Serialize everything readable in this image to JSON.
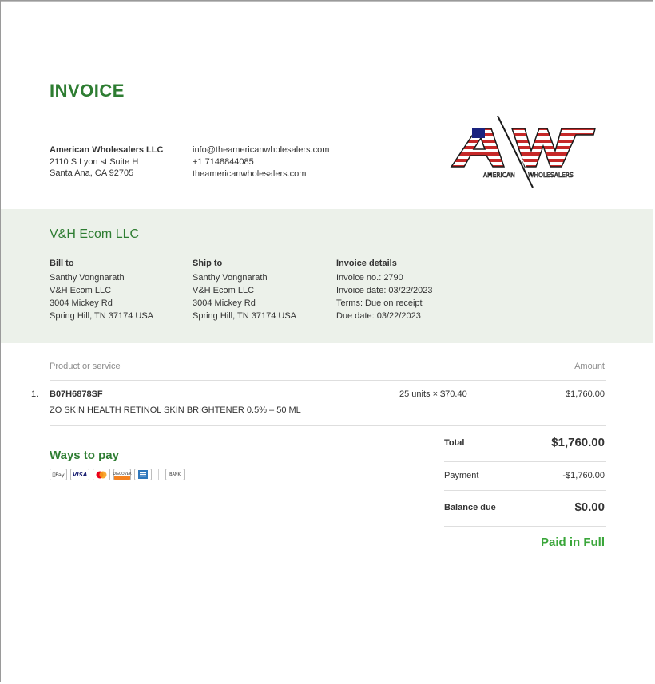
{
  "invoice": {
    "title": "INVOICE"
  },
  "seller": {
    "name": "American Wholesalers LLC",
    "address_line1": "2110 S Lyon st Suite H",
    "address_line2": "Santa Ana, CA 92705",
    "email": "info@theamericanwholesalers.com",
    "phone": "+1 7148844085",
    "website": "theamericanwholesalers.com",
    "logo": {
      "mark": "AW",
      "subtitle_left": "AMERICAN",
      "subtitle_right": "WHOLESALERS"
    }
  },
  "customer": {
    "name": "V&H Ecom LLC"
  },
  "bill_to": {
    "heading": "Bill to",
    "lines": [
      "Santhy Vongnarath",
      "V&H Ecom LLC",
      "3004 Mickey Rd",
      "Spring Hill, TN 37174 USA"
    ]
  },
  "ship_to": {
    "heading": "Ship to",
    "lines": [
      "Santhy Vongnarath",
      "V&H Ecom LLC",
      "3004 Mickey Rd",
      "Spring Hill, TN 37174 USA"
    ]
  },
  "invoice_details": {
    "heading": "Invoice details",
    "lines": [
      "Invoice no.: 2790",
      "Invoice date: 03/22/2023",
      "Terms: Due on receipt",
      "Due date: 03/22/2023"
    ]
  },
  "table": {
    "col_product": "Product or service",
    "col_amount": "Amount",
    "items": [
      {
        "no": "1.",
        "sku": "B07H6878SF",
        "description": "ZO SKIN HEALTH RETINOL SKIN BRIGHTENER 0.5% – 50 ML",
        "qty_price": "25 units × $70.40",
        "amount": "$1,760.00"
      }
    ]
  },
  "payment_methods": {
    "heading": "Ways to pay",
    "icons": [
      "apple-pay-icon",
      "visa-icon",
      "mastercard-icon",
      "discover-icon",
      "amex-icon",
      "bank-icon"
    ],
    "apple_pay_label": "Pay",
    "visa_label": "VISA",
    "discover_label": "DISCOVER",
    "bank_label": "BANK"
  },
  "totals": {
    "total_label": "Total",
    "total_value": "$1,760.00",
    "payment_label": "Payment",
    "payment_value": "-$1,760.00",
    "balance_label": "Balance due",
    "balance_value": "$0.00",
    "status": "Paid in Full"
  },
  "colors": {
    "accent": "#2e7d32",
    "paid": "#3aa63a",
    "band": "#ecf1ea"
  }
}
